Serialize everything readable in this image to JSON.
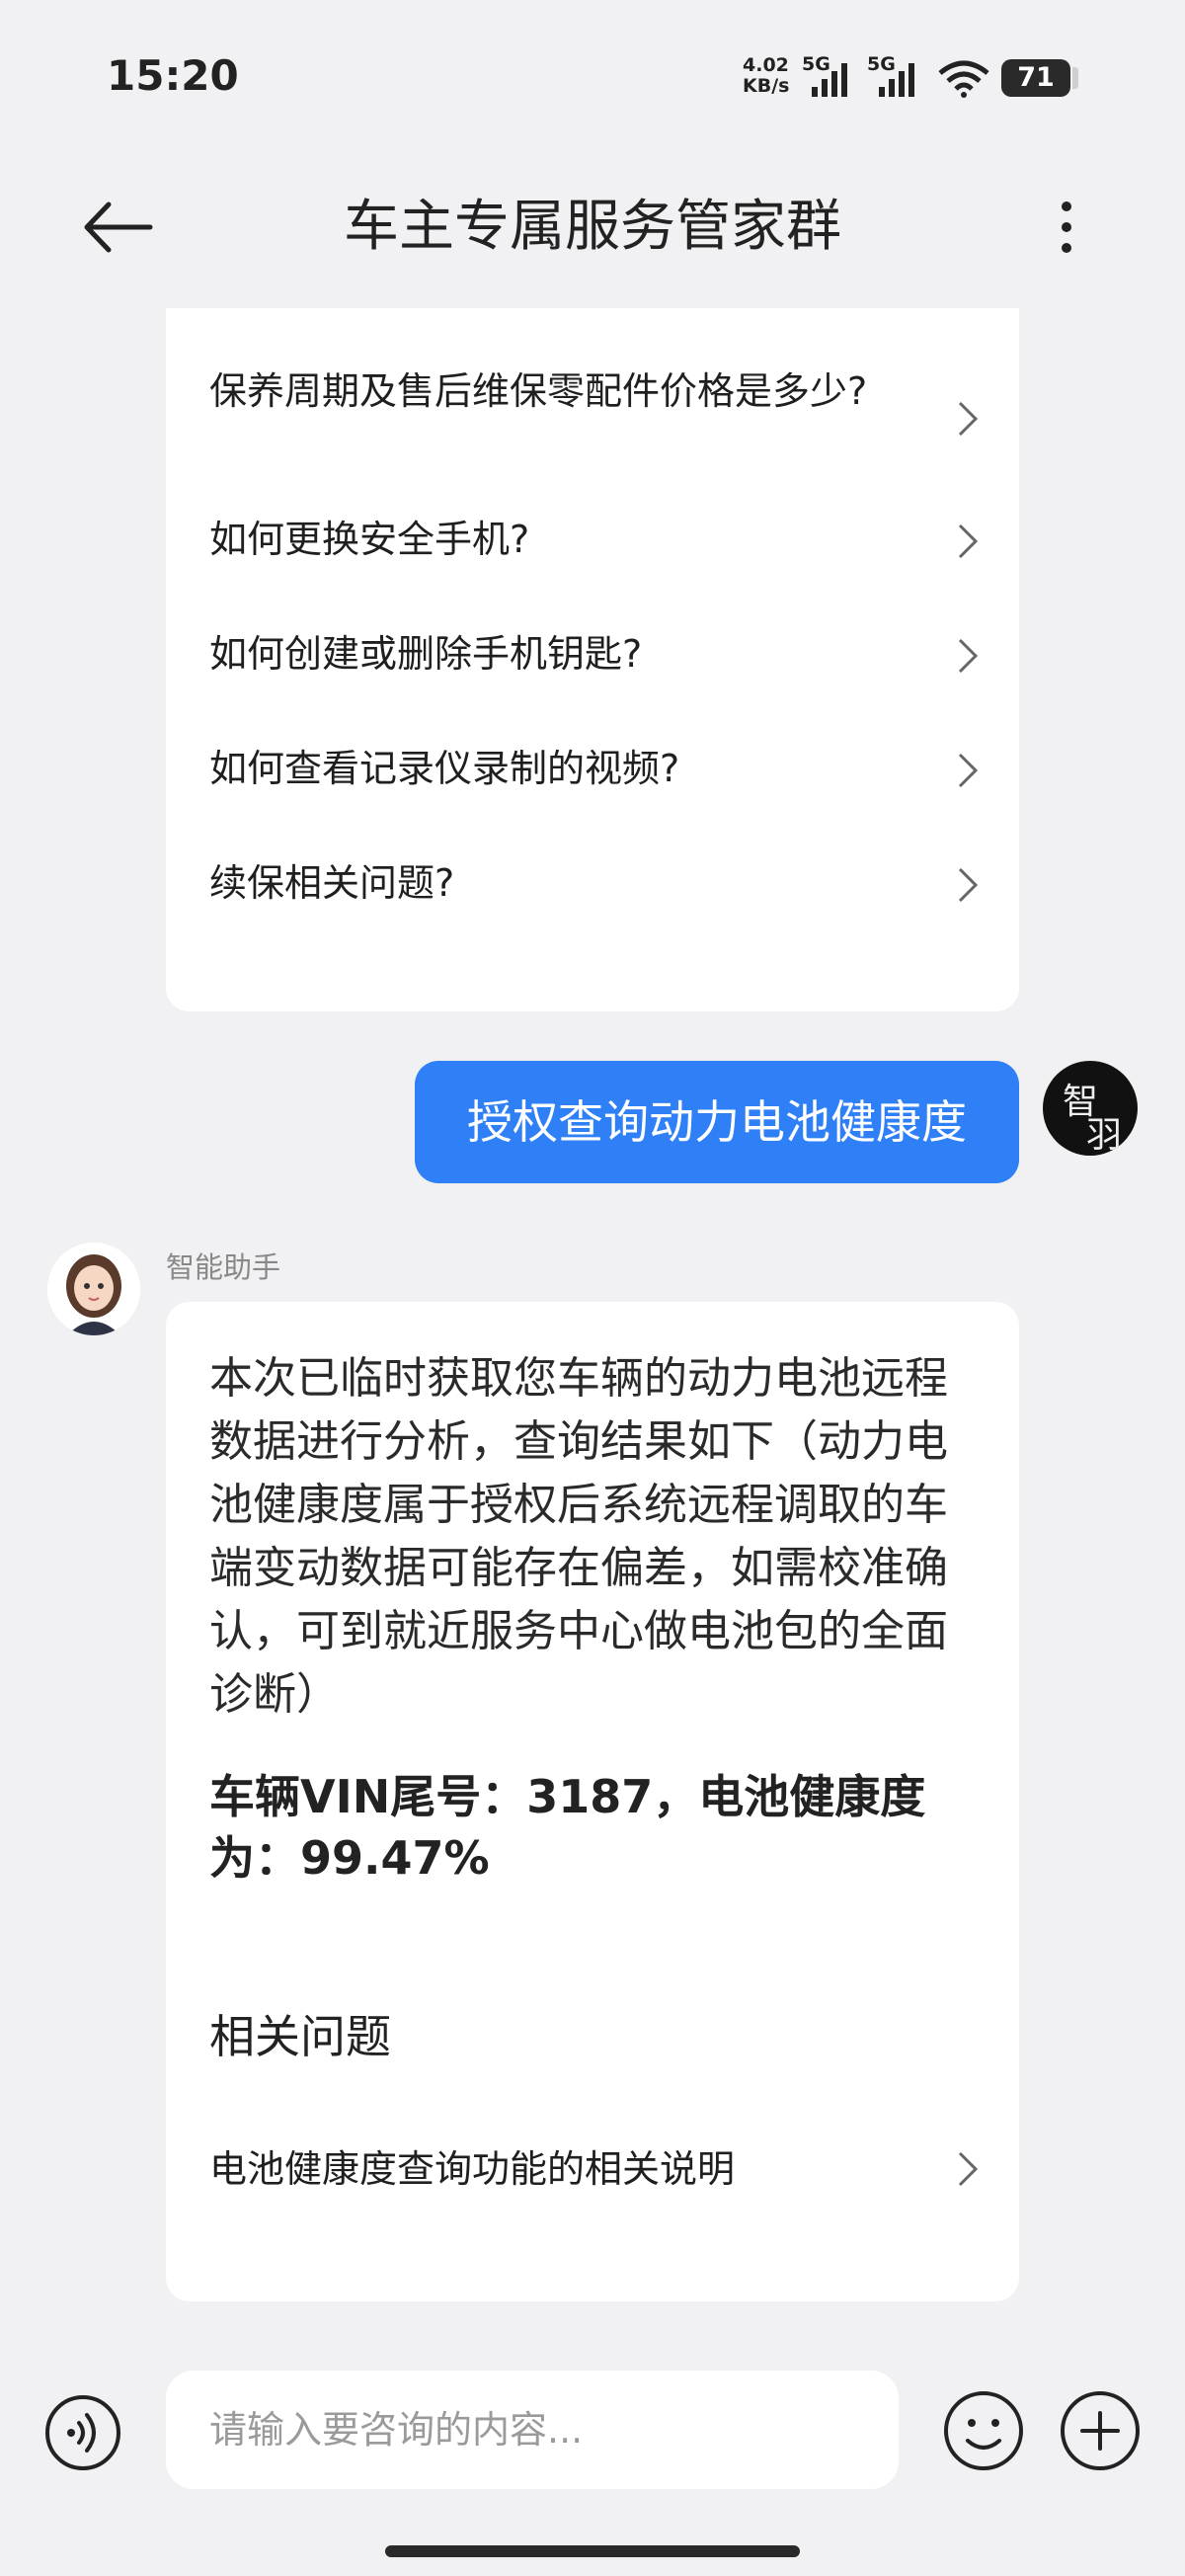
{
  "status_bar": {
    "time": "15:20",
    "speed_value": "4.02",
    "speed_unit": "KB/s",
    "net1": "5G",
    "net2": "5G",
    "battery": "71"
  },
  "header": {
    "title": "车主专属服务管家群"
  },
  "faq": {
    "items": [
      {
        "label": "保养周期及售后维保零配件价格是多少?"
      },
      {
        "label": "如何更换安全手机?"
      },
      {
        "label": "如何创建或删除手机钥匙?"
      },
      {
        "label": "如何查看记录仪录制的视频?"
      },
      {
        "label": "续保相关问题?"
      }
    ]
  },
  "user_message": {
    "text": "授权查询动力电池健康度",
    "avatar_chars": [
      "智",
      "羽"
    ]
  },
  "bot_message": {
    "sender": "智能助手",
    "body": "本次已临时获取您车辆的动力电池远程数据进行分析，查询结果如下（动力电池健康度属于授权后系统远程调取的车端变动数据可能存在偏差，如需校准确认，可到就近服务中心做电池包的全面诊断）",
    "result": "车辆VIN尾号：3187，电池健康度为：99.47%",
    "related_title": "相关问题",
    "related_items": [
      {
        "label": "电池健康度查询功能的相关说明"
      }
    ]
  },
  "composer": {
    "placeholder": "请输入要咨询的内容..."
  },
  "colors": {
    "accent": "#2f80f7",
    "background": "#f1f1f3",
    "card": "#ffffff"
  },
  "icons": [
    "back-arrow-icon",
    "more-vert-icon",
    "chevron-right-icon",
    "voice-icon",
    "emoji-icon",
    "plus-icon",
    "signal-icon",
    "wifi-icon",
    "battery-icon"
  ]
}
